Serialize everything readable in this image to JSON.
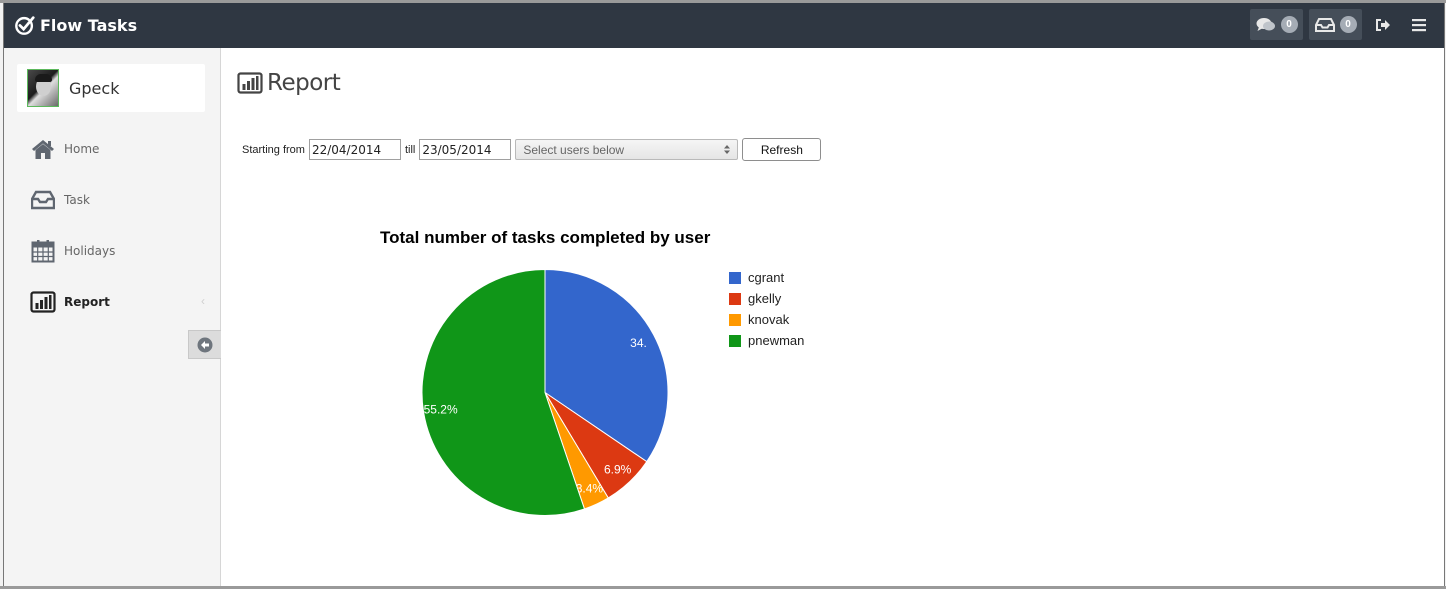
{
  "app": {
    "title": "Flow Tasks"
  },
  "header": {
    "messages_count": "0",
    "inbox_count": "0",
    "icons": [
      "comments-icon",
      "inbox-icon",
      "sign-out-icon",
      "menu-icon"
    ]
  },
  "sidebar": {
    "user_name": "Gpeck",
    "items": [
      {
        "label": "Home",
        "icon": "home-icon",
        "active": false
      },
      {
        "label": "Task",
        "icon": "inbox-icon",
        "active": false
      },
      {
        "label": "Holidays",
        "icon": "calendar-icon",
        "active": false
      },
      {
        "label": "Report",
        "icon": "bar-chart-icon",
        "active": true
      }
    ]
  },
  "page": {
    "title": "Report"
  },
  "filters": {
    "starting_from_label": "Starting from",
    "start_date": "22/04/2014",
    "till_label": "till",
    "end_date": "23/05/2014",
    "users_select": "Select users below",
    "refresh_label": "Refresh"
  },
  "chart_data": {
    "type": "pie",
    "title": "Total number of tasks completed by user",
    "legend_position": "right",
    "categories": [
      "cgrant",
      "gkelly",
      "knovak",
      "pnewman"
    ],
    "values": [
      34.5,
      6.9,
      3.4,
      55.2
    ],
    "labels": [
      "34.",
      "6.9%",
      "3.4%",
      "55.2%"
    ],
    "colors": [
      "#3366cc",
      "#dc3912",
      "#ff9900",
      "#109618"
    ]
  }
}
